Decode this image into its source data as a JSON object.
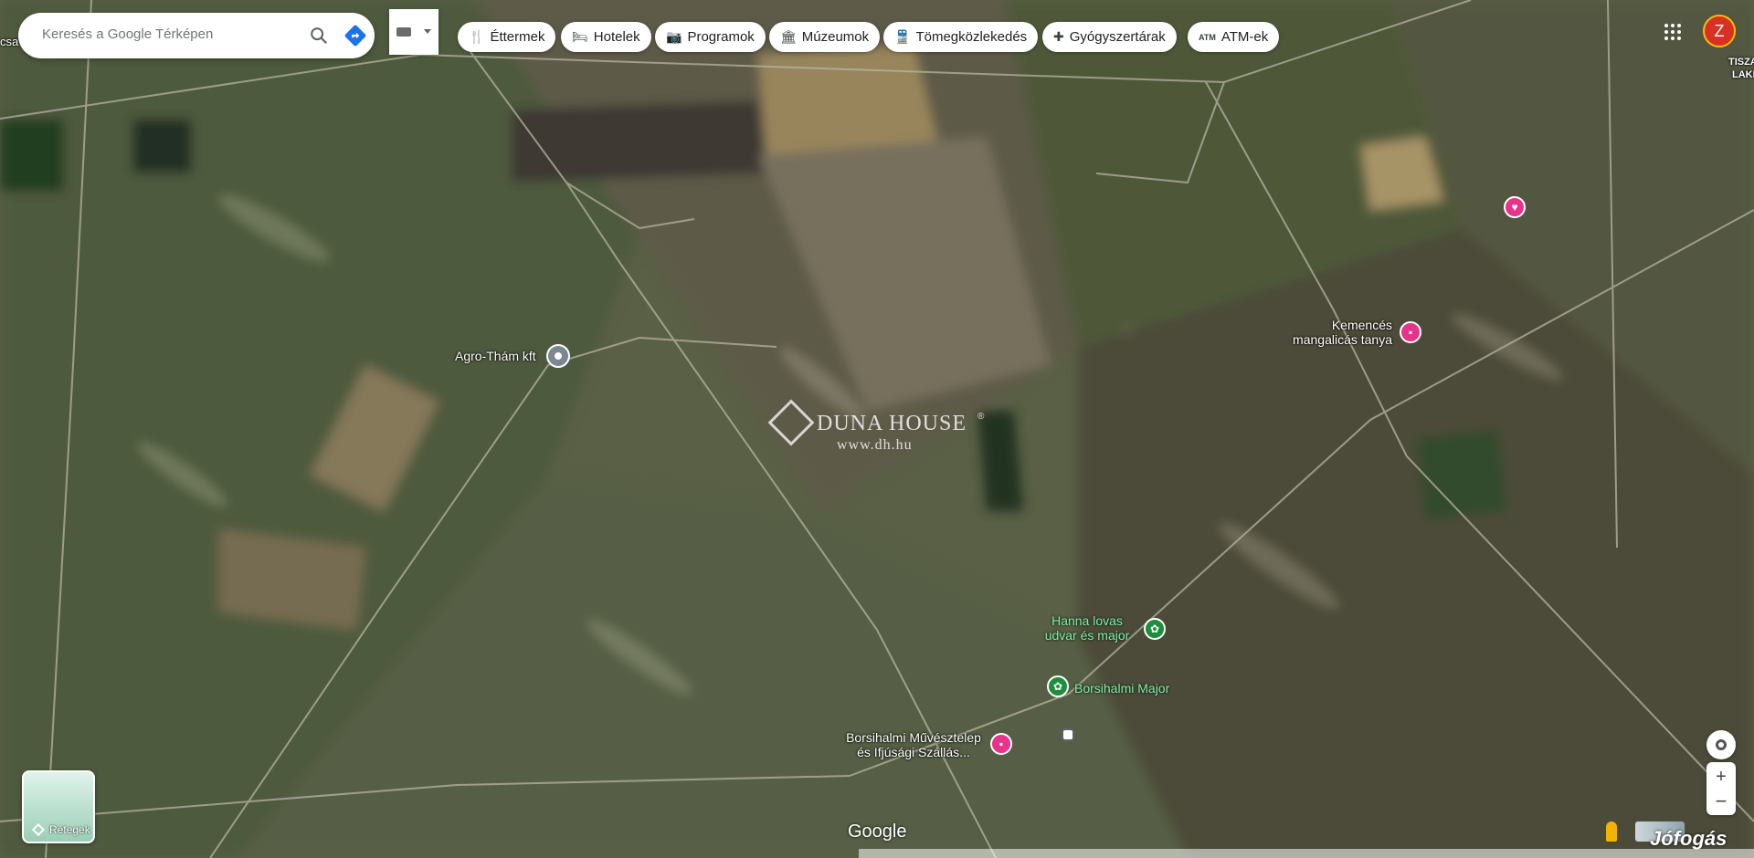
{
  "search": {
    "placeholder": "Keresés a Google Térképen"
  },
  "categories": [
    {
      "label": "Éttermek",
      "icon": "restaurant-icon",
      "glyph": "🍴"
    },
    {
      "label": "Hotelek",
      "icon": "hotel-icon",
      "glyph": "🛏"
    },
    {
      "label": "Programok",
      "icon": "camera-icon",
      "glyph": "📷"
    },
    {
      "label": "Múzeumok",
      "icon": "museum-icon",
      "glyph": "🏛"
    },
    {
      "label": "Tömegközlekedés",
      "icon": "transit-icon",
      "glyph": "🚆"
    },
    {
      "label": "Gyógyszertárak",
      "icon": "pharmacy-icon",
      "glyph": "✚"
    },
    {
      "label": "ATM-ek",
      "icon": "atm-icon",
      "glyph": "ATM"
    }
  ],
  "account": {
    "initial": "Z"
  },
  "places": {
    "agro": "Agro-Thám kft",
    "kemences_1": "Kemencés",
    "kemences_2": "mangalicás tanya",
    "hanna_1": "Hanna lovas",
    "hanna_2": "udvar és major",
    "borsihalmi_major": "Borsihalmi Major",
    "muvesztelep_1": "Borsihalmi Művésztelep",
    "muvesztelep_2": "és Ifjúsági Szállás..."
  },
  "edge_labels": {
    "left": "csa",
    "right_1": "TISZA",
    "right_2": "LAKE"
  },
  "watermark": {
    "brand": "DUNA HOUSE",
    "reg": "®",
    "url": "www.dh.hu"
  },
  "layers": {
    "label": "Rétegek"
  },
  "google_logo": "Google",
  "jofogas": "Jófogás",
  "colors": {
    "hotel_pin": "#e8338a",
    "park_pin": "#1e8e3e",
    "search_blue": "#1a73e8",
    "avatar": "#d93025"
  }
}
